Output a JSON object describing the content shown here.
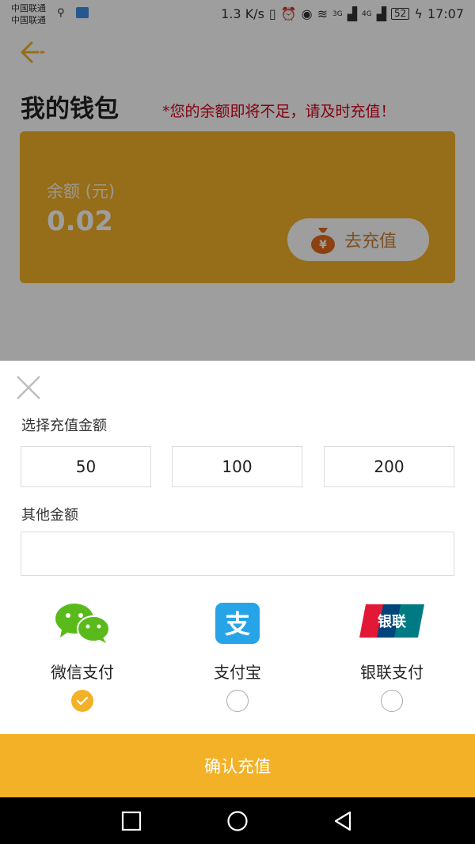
{
  "status_bar": {
    "carrier_1": "中国联通",
    "carrier_2": "中国联通",
    "net_speed": "1.3 K/s",
    "signal_1": "3G",
    "signal_2": "4G",
    "battery": "52",
    "time": "17:07"
  },
  "header": {
    "title": "我的钱包",
    "warning": "*您的余额即将不足，请及时充值！"
  },
  "wallet": {
    "balance_label": "余额 (元)",
    "balance_value": "0.02",
    "topup_label": "去充值",
    "moneybag_glyph": "¥"
  },
  "sheet": {
    "amount_label": "选择充值金额",
    "amounts": [
      "50",
      "100",
      "200"
    ],
    "other_label": "其他金额",
    "other_value": "",
    "payments": [
      {
        "label": "微信支付",
        "selected": true
      },
      {
        "label": "支付宝",
        "selected": false
      },
      {
        "label": "银联支付",
        "selected": false
      }
    ],
    "alipay_glyph": "支",
    "unionpay_glyph": "银联",
    "confirm_label": "确认充值"
  },
  "colors": {
    "accent": "#f3b128",
    "warning": "#d6001c",
    "wechat": "#5aba1c",
    "alipay": "#27a4e8"
  }
}
